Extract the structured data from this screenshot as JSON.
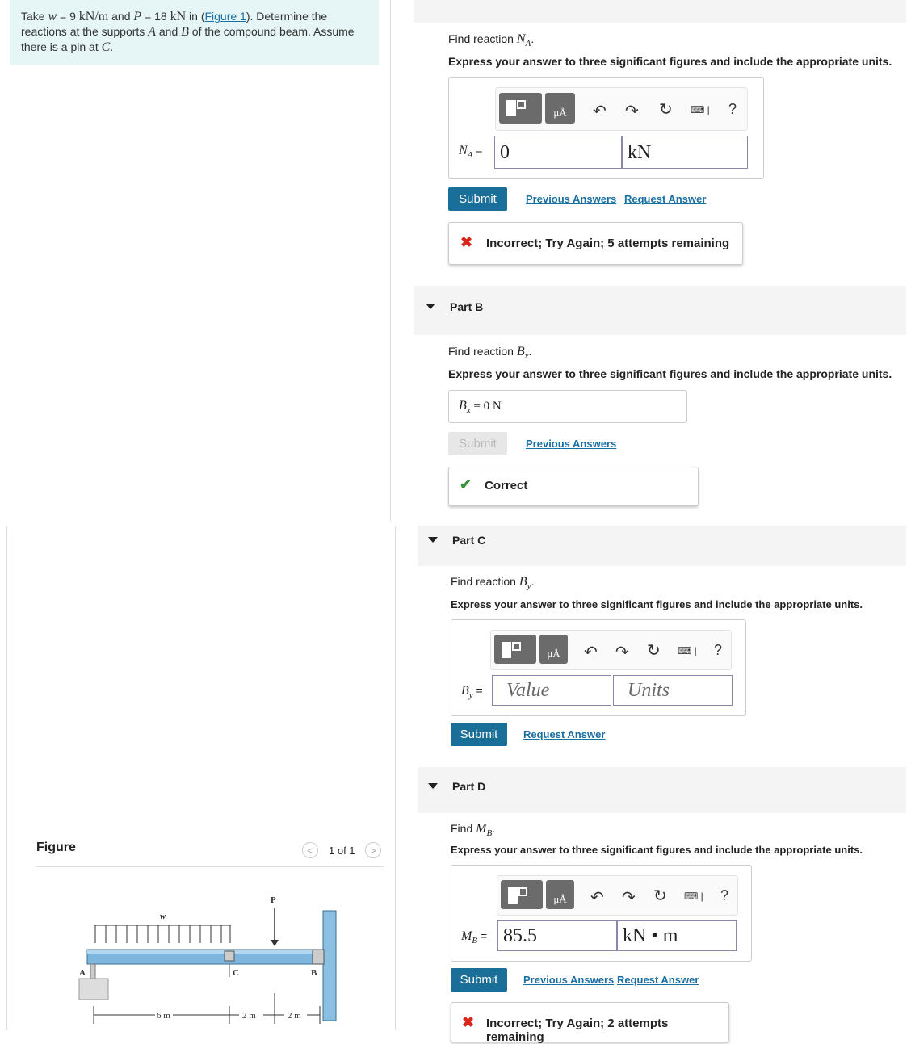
{
  "problem": {
    "t1": "Take ",
    "w_var": "w",
    "t2": " = 9 ",
    "w_unit": "kN/m",
    "t3": " and ",
    "p_var": "P",
    "t4": " = 18 ",
    "p_unit": "kN",
    "t5": " in (",
    "figure_link": "Figure 1",
    "t6": "). Determine the reactions at the supports ",
    "a_var": "A",
    "t7": " and ",
    "b_var": "B",
    "t8": " of the compound beam. Assume there is a pin at ",
    "c_var": "C",
    "t9": "."
  },
  "figure": {
    "title": "Figure",
    "pager": "1 of 1",
    "prev": "<",
    "next": ">",
    "labels": {
      "w": "w",
      "p": "P",
      "a": "A",
      "b": "B",
      "c": "C",
      "d1": "6 m",
      "d2": "2 m",
      "d3": "2 m"
    }
  },
  "toolbar": {
    "mu": "μÅ",
    "help": "?"
  },
  "partA": {
    "question": "Find reaction ",
    "var": "N",
    "sub": "A",
    "instructions": "Express your answer to three significant figures and include the appropriate units.",
    "label": "N",
    "label_sub": "A",
    "label_eq": " =",
    "value": "0",
    "units": "kN",
    "submit": "Submit",
    "prev_answers": "Previous Answers",
    "request_answer": "Request Answer",
    "feedback": "Incorrect; Try Again; 5 attempts remaining"
  },
  "partB": {
    "title": "Part B",
    "question": "Find reaction ",
    "var": "B",
    "sub": "x",
    "instructions": "Express your answer to three significant figures and include the appropriate units.",
    "answer_var": "B",
    "answer_sub": "x",
    "answer_rest": " =  0 N",
    "submit": "Submit",
    "prev_answers": "Previous Answers",
    "feedback": "Correct"
  },
  "partC": {
    "title": "Part C",
    "question": "Find reaction ",
    "var": "B",
    "sub": "y",
    "instructions": "Express your answer to three significant figures and include the appropriate units.",
    "label": "B",
    "label_sub": "y",
    "label_eq": " =",
    "value_placeholder": "Value",
    "units_placeholder": "Units",
    "submit": "Submit",
    "request_answer": "Request Answer"
  },
  "partD": {
    "title": "Part D",
    "question": "Find ",
    "var": "M",
    "sub": "B",
    "instructions": "Express your answer to three significant figures and include the appropriate units.",
    "label": "M",
    "label_sub": "B",
    "label_eq": " =",
    "value": "85.5",
    "units": "kN • m",
    "submit": "Submit",
    "prev_answers": "Previous Answers",
    "request_answer": "Request Answer",
    "feedback": "Incorrect; Try Again; 2 attempts remaining"
  },
  "colors": {
    "accent": "#1a6f99",
    "error": "#d9251c",
    "success": "#3a8f3a",
    "problem_bg": "#e6f5f6"
  }
}
